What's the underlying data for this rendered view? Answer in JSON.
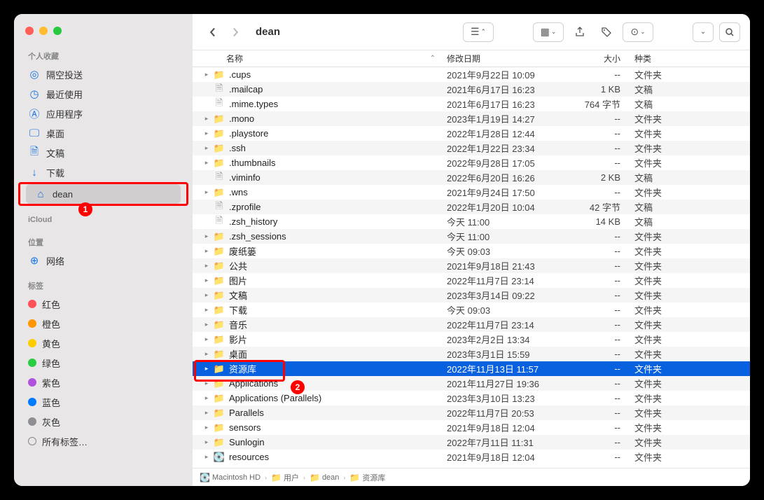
{
  "location_title": "dean",
  "sidebar": {
    "favorites_heading": "个人收藏",
    "favorites": [
      {
        "label": "隔空投送",
        "icon": "airdrop"
      },
      {
        "label": "最近使用",
        "icon": "clock"
      },
      {
        "label": "应用程序",
        "icon": "app"
      },
      {
        "label": "桌面",
        "icon": "desktop"
      },
      {
        "label": "文稿",
        "icon": "doc"
      },
      {
        "label": "下载",
        "icon": "down"
      },
      {
        "label": "dean",
        "icon": "home",
        "selected": true,
        "highlight_box": true
      }
    ],
    "icloud_heading": "iCloud",
    "locations_heading": "位置",
    "locations": [
      {
        "label": "网络",
        "icon": "globe"
      }
    ],
    "tags_heading": "标签",
    "tags": [
      {
        "label": "红色",
        "color": "#ff5257"
      },
      {
        "label": "橙色",
        "color": "#ff9500"
      },
      {
        "label": "黄色",
        "color": "#ffcc00"
      },
      {
        "label": "绿色",
        "color": "#28cd41"
      },
      {
        "label": "紫色",
        "color": "#af52de"
      },
      {
        "label": "蓝色",
        "color": "#007aff"
      },
      {
        "label": "灰色",
        "color": "#8e8e93"
      },
      {
        "label": "所有标签…",
        "all": true
      }
    ]
  },
  "columns": {
    "name": "名称",
    "date": "修改日期",
    "size": "大小",
    "kind": "种类"
  },
  "rows": [
    {
      "name": ".cups",
      "date": "2021年9月22日 10:09",
      "size": "--",
      "kind": "文件夹",
      "expandable": true,
      "type": "folder-dim"
    },
    {
      "name": ".mailcap",
      "date": "2021年6月17日 16:23",
      "size": "1 KB",
      "kind": "文稿",
      "type": "file"
    },
    {
      "name": ".mime.types",
      "date": "2021年6月17日 16:23",
      "size": "764 字节",
      "kind": "文稿",
      "type": "file"
    },
    {
      "name": ".mono",
      "date": "2023年1月19日 14:27",
      "size": "--",
      "kind": "文件夹",
      "expandable": true,
      "type": "folder-dim"
    },
    {
      "name": ".playstore",
      "date": "2022年1月28日 12:44",
      "size": "--",
      "kind": "文件夹",
      "expandable": true,
      "type": "folder-dim"
    },
    {
      "name": ".ssh",
      "date": "2022年1月22日 23:34",
      "size": "--",
      "kind": "文件夹",
      "expandable": true,
      "type": "folder-dim"
    },
    {
      "name": ".thumbnails",
      "date": "2022年9月28日 17:05",
      "size": "--",
      "kind": "文件夹",
      "expandable": true,
      "type": "folder-dim"
    },
    {
      "name": ".viminfo",
      "date": "2022年6月20日 16:26",
      "size": "2 KB",
      "kind": "文稿",
      "type": "file"
    },
    {
      "name": ".wns",
      "date": "2021年9月24日 17:50",
      "size": "--",
      "kind": "文件夹",
      "expandable": true,
      "type": "folder-dim"
    },
    {
      "name": ".zprofile",
      "date": "2022年1月20日 10:04",
      "size": "42 字节",
      "kind": "文稿",
      "type": "file"
    },
    {
      "name": ".zsh_history",
      "date": "今天 11:00",
      "size": "14 KB",
      "kind": "文稿",
      "type": "file"
    },
    {
      "name": ".zsh_sessions",
      "date": "今天 11:00",
      "size": "--",
      "kind": "文件夹",
      "expandable": true,
      "type": "folder-dim"
    },
    {
      "name": "废纸篓",
      "date": "今天 09:03",
      "size": "--",
      "kind": "文件夹",
      "expandable": true,
      "type": "folder-dim"
    },
    {
      "name": "公共",
      "date": "2021年9月18日 21:43",
      "size": "--",
      "kind": "文件夹",
      "expandable": true,
      "type": "folder"
    },
    {
      "name": "图片",
      "date": "2022年11月7日 23:14",
      "size": "--",
      "kind": "文件夹",
      "expandable": true,
      "type": "folder"
    },
    {
      "name": "文稿",
      "date": "2023年3月14日 09:22",
      "size": "--",
      "kind": "文件夹",
      "expandable": true,
      "type": "folder"
    },
    {
      "name": "下载",
      "date": "今天 09:03",
      "size": "--",
      "kind": "文件夹",
      "expandable": true,
      "type": "folder"
    },
    {
      "name": "音乐",
      "date": "2022年11月7日 23:14",
      "size": "--",
      "kind": "文件夹",
      "expandable": true,
      "type": "folder"
    },
    {
      "name": "影片",
      "date": "2023年2月2日 13:34",
      "size": "--",
      "kind": "文件夹",
      "expandable": true,
      "type": "folder"
    },
    {
      "name": "桌面",
      "date": "2023年3月1日 15:59",
      "size": "--",
      "kind": "文件夹",
      "expandable": true,
      "type": "folder"
    },
    {
      "name": "资源库",
      "date": "2022年11月13日 11:57",
      "size": "--",
      "kind": "文件夹",
      "expandable": true,
      "type": "folder",
      "selected": true,
      "highlight_box": true
    },
    {
      "name": "Applications",
      "date": "2021年11月27日 19:36",
      "size": "--",
      "kind": "文件夹",
      "expandable": true,
      "type": "folder"
    },
    {
      "name": "Applications (Parallels)",
      "date": "2023年3月10日 13:23",
      "size": "--",
      "kind": "文件夹",
      "expandable": true,
      "type": "folder"
    },
    {
      "name": "Parallels",
      "date": "2022年11月7日 20:53",
      "size": "--",
      "kind": "文件夹",
      "expandable": true,
      "type": "folder"
    },
    {
      "name": "sensors",
      "date": "2021年9月18日 12:04",
      "size": "--",
      "kind": "文件夹",
      "expandable": true,
      "type": "folder"
    },
    {
      "name": "Sunlogin",
      "date": "2022年7月11日 11:31",
      "size": "--",
      "kind": "文件夹",
      "expandable": true,
      "type": "folder"
    },
    {
      "name": "resources",
      "date": "2021年9月18日 12:04",
      "size": "--",
      "kind": "文件夹",
      "expandable": true,
      "type": "folder",
      "disk": true
    }
  ],
  "pathbar": [
    {
      "label": "Macintosh HD",
      "icon": "💽"
    },
    {
      "label": "用户",
      "icon": "📁"
    },
    {
      "label": "dean",
      "icon": "📁"
    },
    {
      "label": "资源库",
      "icon": "📁"
    }
  ],
  "annotations": {
    "badge1": "1",
    "badge2": "2"
  }
}
